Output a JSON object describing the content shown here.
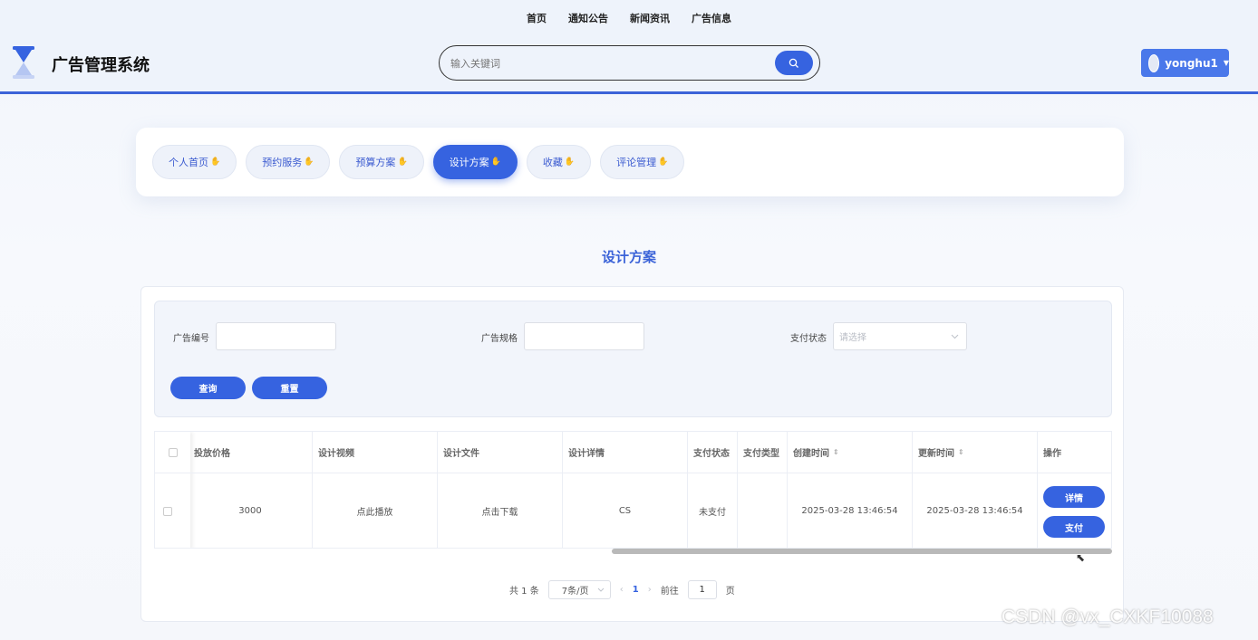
{
  "nav": {
    "items": [
      "首页",
      "通知公告",
      "新闻资讯",
      "广告信息"
    ]
  },
  "brand": {
    "title": "广告管理系统"
  },
  "search": {
    "placeholder": "输入关键词"
  },
  "user": {
    "name": "yonghu1"
  },
  "tabs": [
    {
      "label": "个人首页",
      "active": false
    },
    {
      "label": "预约服务",
      "active": false
    },
    {
      "label": "预算方案",
      "active": false
    },
    {
      "label": "设计方案",
      "active": true
    },
    {
      "label": "收藏",
      "active": false
    },
    {
      "label": "评论管理",
      "active": false
    }
  ],
  "page": {
    "title": "设计方案"
  },
  "filters": {
    "ad_no_label": "广告编号",
    "ad_spec_label": "广告规格",
    "pay_status_label": "支付状态",
    "pay_status_placeholder": "请选择",
    "query_button": "查询",
    "reset_button": "重置"
  },
  "table": {
    "columns": [
      "投放价格",
      "设计视频",
      "设计文件",
      "设计详情",
      "支付状态",
      "支付类型",
      "创建时间",
      "更新时间",
      "操作"
    ],
    "rows": [
      {
        "price": "3000",
        "video": "点此播放",
        "file": "点击下载",
        "detail": "CS",
        "pay_status": "未支付",
        "pay_type": "",
        "created": "2025-03-28 13:46:54",
        "updated": "2025-03-28 13:46:54",
        "actions": [
          "详情",
          "支付"
        ]
      }
    ]
  },
  "pagination": {
    "total": "共 1 条",
    "page_size": "7条/页",
    "current": "1",
    "goto_label": "前往",
    "goto_value": "1",
    "page_unit": "页"
  },
  "watermark": "CSDN @vx_CXKF10088",
  "colors": {
    "primary": "#3663e0",
    "accent_border": "#3b63d8"
  }
}
